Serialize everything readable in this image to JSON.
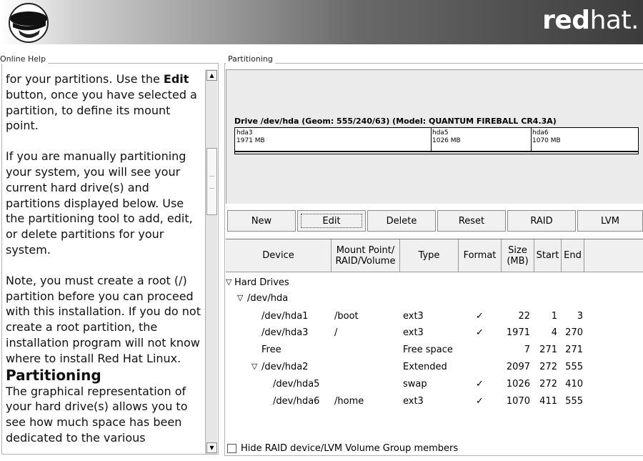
{
  "header": {
    "logo_icon": "redhat-shadowman-logo",
    "brand_bold": "red",
    "brand_light": "hat."
  },
  "help": {
    "frame_title": "Online Help",
    "para1_pre": "for your partitions. Use the ",
    "para1_bold": "Edit",
    "para1_post": " button, once you have selected a partition, to define its mount point.",
    "para2": "If you are manually partitioning your system, you will see your current hard drive(s) and partitions displayed below. Use the partitioning tool to add, edit, or delete partitions for your system.",
    "para3": "Note, you must create a root (/) partition before you can proceed with this installation. If you do not create a root partition, the installation program will not know where to install Red Hat Linux.",
    "heading": "Partitioning",
    "para4": "The graphical representation of your hard drive(s) allows you to see how much space has been dedicated to the various"
  },
  "partitioning": {
    "frame_title": "Partitioning",
    "drive_label": "Drive /dev/hda (Geom: 555/240/63) (Model: QUANTUM FIREBALL CR4.3A)",
    "segments": [
      {
        "name": "hda3",
        "size": "1971 MB"
      },
      {
        "name": "hda5",
        "size": "1026 MB"
      },
      {
        "name": "hda6",
        "size": "1070 MB"
      }
    ]
  },
  "toolbar": {
    "new": "New",
    "edit": "Edit",
    "delete": "Delete",
    "reset": "Reset",
    "raid": "RAID",
    "lvm": "LVM"
  },
  "table": {
    "headers": {
      "device": "Device",
      "mount1": "Mount Point/",
      "mount2": "RAID/Volume",
      "type": "Type",
      "format": "Format",
      "size1": "Size",
      "size2": "(MB)",
      "start": "Start",
      "end": "End"
    },
    "tree": {
      "hard_drives": "Hard Drives",
      "dev_hda": "/dev/hda"
    },
    "rows": [
      {
        "device": "/dev/hda1",
        "mount": "/boot",
        "type": "ext3",
        "format": "✓",
        "size": "22",
        "start": "1",
        "end": "3"
      },
      {
        "device": "/dev/hda3",
        "mount": "/",
        "type": "ext3",
        "format": "✓",
        "size": "1971",
        "start": "4",
        "end": "270"
      },
      {
        "device": "Free",
        "mount": "",
        "type": "Free space",
        "format": "",
        "size": "7",
        "start": "271",
        "end": "271"
      },
      {
        "device": "/dev/hda2",
        "mount": "",
        "type": "Extended",
        "format": "",
        "size": "2097",
        "start": "272",
        "end": "555"
      },
      {
        "device": "/dev/hda5",
        "mount": "",
        "type": "swap",
        "format": "✓",
        "size": "1026",
        "start": "272",
        "end": "410"
      },
      {
        "device": "/dev/hda6",
        "mount": "/home",
        "type": "ext3",
        "format": "✓",
        "size": "1070",
        "start": "411",
        "end": "555"
      }
    ]
  },
  "hide_raid": {
    "label": "Hide RAID device/LVM Volume Group members",
    "checked": false
  }
}
